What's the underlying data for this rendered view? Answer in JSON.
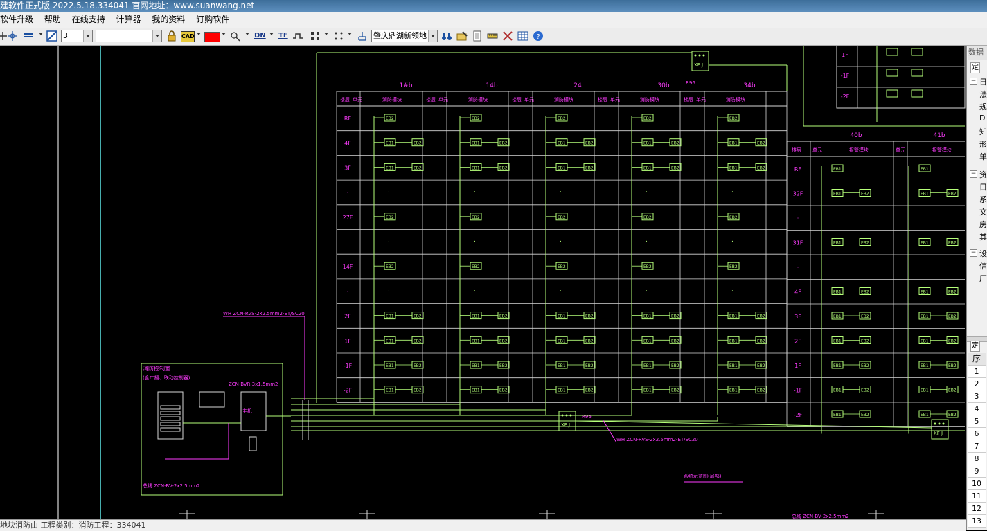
{
  "window": {
    "title": "建软件正式版 2022.5.18.334041 官网地址：www.suanwang.net"
  },
  "menu": {
    "items": [
      "软件升级",
      "帮助",
      "在线支持",
      "计算器",
      "我的资料",
      "订购软件"
    ]
  },
  "toolbar": {
    "lineweight_value": "3",
    "layer_value": "",
    "color_value": "#ff0000",
    "project_value": "肇庆鼎湖新领地",
    "dn_label": "DN",
    "tf_label": "TF",
    "cad_label": "CAD"
  },
  "drawing": {
    "header_cols": [
      "1#b",
      "14b",
      "24",
      "30b",
      "34b"
    ],
    "header_cols_right": [
      "40b",
      "41b"
    ],
    "floors_left": [
      "RF",
      "4F",
      "3F",
      "·",
      "27F",
      "·",
      "14F",
      "·",
      "2F",
      "1F",
      "-1F",
      "-2F"
    ],
    "floors_right": [
      "RF",
      "32F",
      "·",
      "31F",
      "·",
      "4F",
      "3F",
      "2F",
      "1F",
      "-1F",
      "-2F"
    ],
    "floors_top_right": [
      "1F",
      "-1F",
      "-2F"
    ],
    "col_sub_a": "楼层",
    "col_sub_b": "单元",
    "col_sub_c": "消防模块",
    "col_sub_c_right": "报警模块",
    "module_label": "XF J",
    "cable_note": "WH ZCN-RVS-2x2.5mm2-ET/SC20",
    "cable_note_2": "WH ZCN-RVS-2x2.5mm2-ET/SC20",
    "panel_title": "消防控制室",
    "panel_sub": "(含广播、联动控制器)",
    "panel_box_label": "ZCN-BVR-3x1.5mm2",
    "unit_label": "主机",
    "bottom_note": "总线 ZCN-BV-2x2.5mm2",
    "system_note": "系统示意图(局部)",
    "label_rj": "R96",
    "cell_low": "EB2",
    "cell_pair_a": "EB1",
    "cell_pair_b": "EB2"
  },
  "right_panel": {
    "header": "数据",
    "items": [
      "定",
      "日",
      "法",
      "规",
      "D",
      "知",
      "形",
      "单",
      "资",
      "目",
      "系",
      "文",
      "房",
      "其",
      "设",
      "信",
      "厂"
    ],
    "table_header": "序",
    "rows": [
      "1",
      "2",
      "3",
      "4",
      "5",
      "6",
      "7",
      "8",
      "9",
      "10",
      "11",
      "12",
      "13"
    ]
  },
  "status": {
    "text": "地块消防由 工程类别：消防工程：334041"
  },
  "colors": {
    "cad_bg": "#000000",
    "green": "#b6ff7a",
    "magenta": "#ff3cff",
    "white": "#ffffff",
    "cyan": "#5fe8e8",
    "title_bg": "#4a7eae"
  }
}
